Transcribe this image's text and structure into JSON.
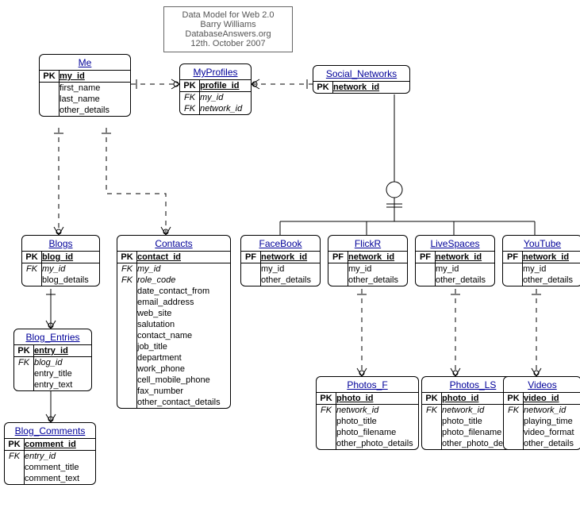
{
  "note": {
    "l1": "Data Model for Web 2.0",
    "l2": "Barry Williams",
    "l3": "DatabaseAnswers.org",
    "l4": "12th. October 2007"
  },
  "entities": {
    "me": {
      "title": "Me",
      "pk": "PK",
      "f0": "my_id",
      "f1": "first_name",
      "f2": "last_name",
      "f3": "other_details"
    },
    "myprofiles": {
      "title": "MyProfiles",
      "pk": "PK",
      "f0": "profile_id",
      "fk1k": "FK",
      "fk1": "my_id",
      "fk2k": "FK",
      "fk2": "network_id"
    },
    "social_networks": {
      "title": "Social_Networks",
      "pk": "PK",
      "f0": "network_id"
    },
    "blogs": {
      "title": "Blogs",
      "pk": "PK",
      "f0": "blog_id",
      "fk1k": "FK",
      "fk1": "my_id",
      "f2": "blog_details"
    },
    "contacts": {
      "title": "Contacts",
      "pk": "PK",
      "f0": "contact_id",
      "fk1k": "FK",
      "fk1": "my_id",
      "fk2k": "FK",
      "fk2": "role_code",
      "f3": "date_contact_from",
      "f4": "email_address",
      "f5": "web_site",
      "f6": "salutation",
      "f7": "contact_name",
      "f8": "job_title",
      "f9": "department",
      "f10": "work_phone",
      "f11": "cell_mobile_phone",
      "f12": "fax_number",
      "f13": "other_contact_details"
    },
    "blog_entries": {
      "title": "Blog_Entries",
      "pk": "PK",
      "f0": "entry_id",
      "fk1k": "FK",
      "fk1": "blog_id",
      "f2": "entry_title",
      "f3": "entry_text"
    },
    "blog_comments": {
      "title": "Blog_Comments",
      "pk": "PK",
      "f0": "comment_id",
      "fk1k": "FK",
      "fk1": "entry_id",
      "f2": "comment_title",
      "f3": "comment_text"
    },
    "facebook": {
      "title": "FaceBook",
      "pfk": "PF",
      "f0": "network_id",
      "f1": "my_id",
      "f2": "other_details"
    },
    "flickr": {
      "title": "FlickR",
      "pfk": "PF",
      "f0": "network_id",
      "f1": "my_id",
      "f2": "other_details"
    },
    "livespaces": {
      "title": "LiveSpaces",
      "pfk": "PF",
      "f0": "network_id",
      "f1": "my_id",
      "f2": "other_details"
    },
    "youtube": {
      "title": "YouTube",
      "pfk": "PF",
      "f0": "network_id",
      "f1": "my_id",
      "f2": "other_details"
    },
    "photos_f": {
      "title": "Photos_F",
      "pk": "PK",
      "f0": "photo_id",
      "fk1k": "FK",
      "fk1": "network_id",
      "f2": "photo_title",
      "f3": "photo_filename",
      "f4": "other_photo_details"
    },
    "photos_ls": {
      "title": "Photos_LS",
      "pk": "PK",
      "f0": "photo_id",
      "fk1k": "FK",
      "fk1": "network_id",
      "f2": "photo_title",
      "f3": "photo_filename",
      "f4": "other_photo_details"
    },
    "videos": {
      "title": "Videos",
      "pk": "PK",
      "f0": "video_id",
      "fk1k": "FK",
      "fk1": "network_id",
      "f2": "playing_time",
      "f3": "video_format",
      "f4": "other_details"
    }
  }
}
